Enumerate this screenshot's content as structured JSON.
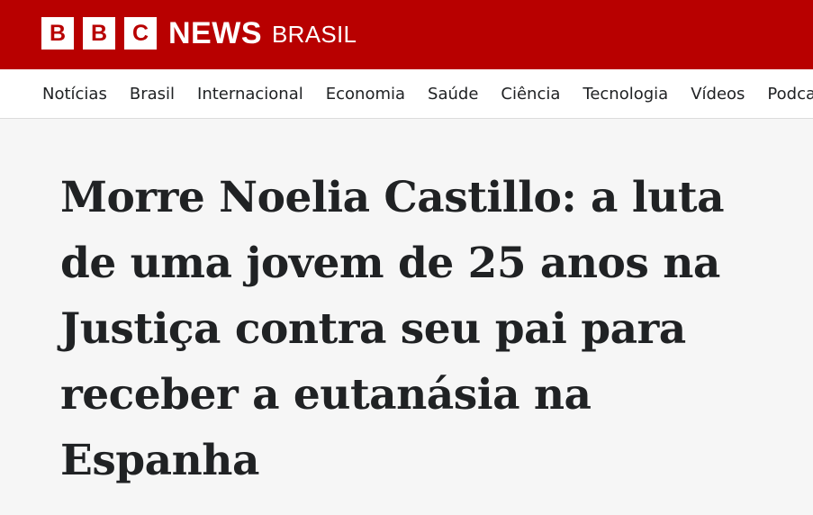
{
  "header": {
    "logo_letters": [
      "B",
      "B",
      "C"
    ],
    "logo_news": "NEWS",
    "logo_region": "BRASIL",
    "background_color": "#b80000"
  },
  "nav": {
    "items": [
      {
        "label": "Notícias"
      },
      {
        "label": "Brasil"
      },
      {
        "label": "Internacional"
      },
      {
        "label": "Economia"
      },
      {
        "label": "Saúde"
      },
      {
        "label": "Ciência"
      },
      {
        "label": "Tecnologia"
      },
      {
        "label": "Vídeos"
      },
      {
        "label": "Podcasts"
      }
    ]
  },
  "article": {
    "headline": "Morre Noelia Castillo: a luta de uma jovem de 25 anos na Justiça contra seu pai para receber a eutanásia na Espanha"
  }
}
